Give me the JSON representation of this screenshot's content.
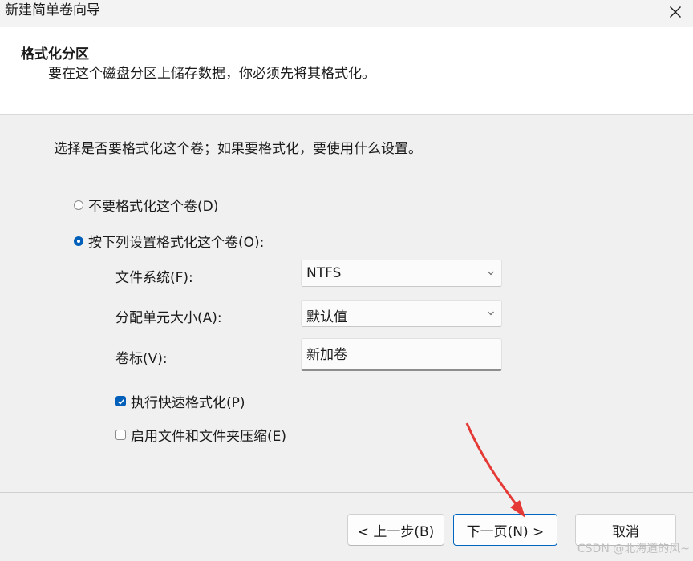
{
  "window": {
    "title": "新建简单卷向导",
    "close_icon": "close-icon"
  },
  "header": {
    "title": "格式化分区",
    "subtitle": "要在这个磁盘分区上储存数据，你必须先将其格式化。"
  },
  "main": {
    "prompt": "选择是否要格式化这个卷；如果要格式化，要使用什么设置。",
    "options": {
      "no_format": {
        "label": "不要格式化这个卷(D)",
        "checked": false
      },
      "format": {
        "label": "按下列设置格式化这个卷(O):",
        "checked": true
      }
    },
    "file_system": {
      "label": "文件系统(F):",
      "value": "NTFS"
    },
    "allocation_unit": {
      "label": "分配单元大小(A):",
      "value": "默认值"
    },
    "volume_label": {
      "label": "卷标(V):",
      "value": "新加卷"
    },
    "quick_format": {
      "label": "执行快速格式化(P)",
      "checked": true
    },
    "compression": {
      "label": "启用文件和文件夹压缩(E)",
      "checked": false
    }
  },
  "footer": {
    "back_label": "< 上一步(B)",
    "next_label": "下一页(N) >",
    "cancel_label": "取消"
  },
  "watermark": "CSDN @北海道的风~",
  "colors": {
    "accent": "#005fb8",
    "annotation_arrow": "#e53935"
  }
}
